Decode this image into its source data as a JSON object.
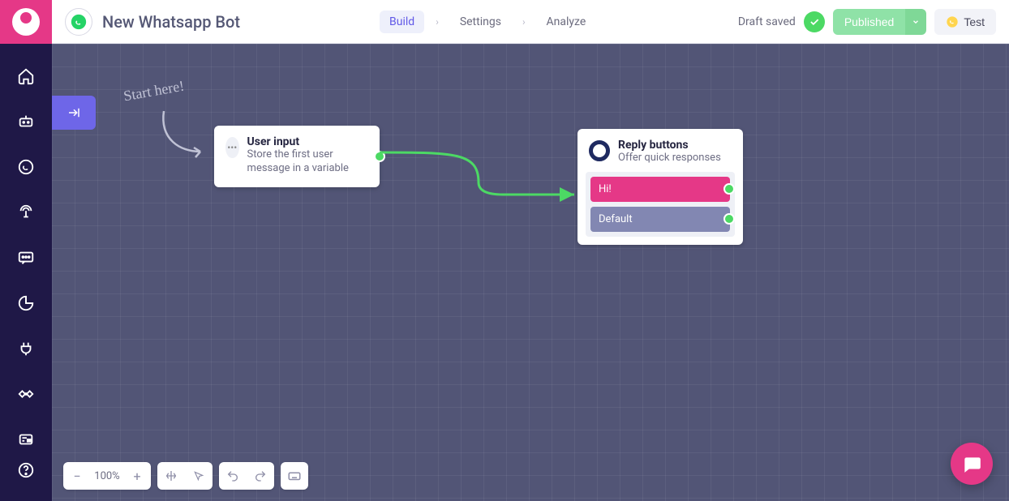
{
  "header": {
    "title": "New Whatsapp Bot",
    "tabs": {
      "build": "Build",
      "settings": "Settings",
      "analyze": "Analyze"
    },
    "draft_status": "Draft saved",
    "publish": "Published",
    "test": "Test"
  },
  "canvas": {
    "start_label": "Start here!",
    "zoom": "100%",
    "nodes": {
      "user_input": {
        "title": "User input",
        "desc": "Store the first user message in a variable"
      },
      "reply_buttons": {
        "title": "Reply buttons",
        "desc": "Offer quick responses",
        "options": [
          {
            "label": "Hi!",
            "variant": "primary"
          },
          {
            "label": "Default",
            "variant": "secondary"
          }
        ]
      }
    }
  },
  "colors": {
    "accent_purple": "#6e66e8",
    "accent_pink": "#e53887",
    "success": "#4cd964",
    "canvas_bg": "#525576"
  }
}
